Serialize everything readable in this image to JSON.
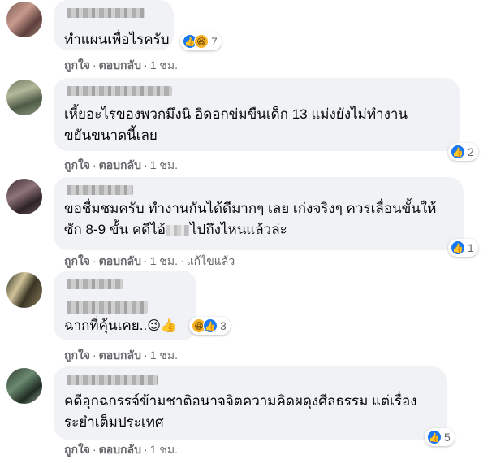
{
  "comments": [
    {
      "lines": [
        "ทำแผนเพื่อไรครับ"
      ],
      "reaction_count": "7",
      "actions": {
        "like": "ถูกใจ",
        "reply": "ตอบกลับ",
        "time": "1 ชม."
      }
    },
    {
      "lines": [
        "เหี้ยอะไรของพวกมึงนิ อิดอกข่มขืนเด็ก 13 แม่งยังไม่ทำงาน",
        "ขยันขนาดนี้เลย"
      ],
      "reaction_count": "2",
      "actions": {
        "like": "ถูกใจ",
        "reply": "ตอบกลับ",
        "time": "1 ชม."
      }
    },
    {
      "lines": [
        "ขอชื่มชมครับ ทำงานกันได้ดีมากๆ เลย เก่งจริงๆ ควรเลื่อนขั้นให้",
        "ซัก 8-9 ขั้น คดีไอ้",
        "ไปถึงไหนแล้วล่ะ"
      ],
      "reaction_count": "1",
      "actions": {
        "like": "ถูกใจ",
        "reply": "ตอบกลับ",
        "time": "1 ชม.",
        "edited": "แก้ไขแล้ว"
      }
    },
    {
      "lines": [
        "ฉากที่คุ้นเคย.."
      ],
      "emojis": "😉👍",
      "reaction_count": "3",
      "actions": {
        "like": "ถูกใจ",
        "reply": "ตอบกลับ",
        "time": "1 ชม."
      }
    },
    {
      "lines": [
        "คดีอุกฉกรรจ์ข้ามชาติอนาจจิตความคิดผดุงศีลธรรม แต่เรื่อง",
        "ระยำเต็มประเทศ"
      ],
      "reaction_count": "5",
      "actions": {
        "like": "ถูกใจ",
        "reply": "ตอบกลับ",
        "time": "1 ชม."
      }
    }
  ],
  "colors": {
    "bubble": "#f0f2f5",
    "like": "#1877f2",
    "meta": "#65676b"
  },
  "icons": [
    "like-icon",
    "haha-icon"
  ]
}
